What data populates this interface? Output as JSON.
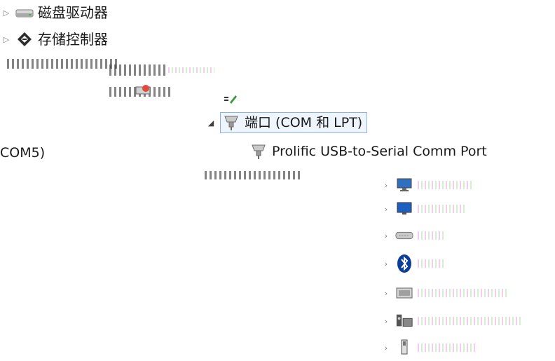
{
  "tree": {
    "disk_drives": {
      "label": "磁盘驱动器",
      "icon": "disk-drive-icon"
    },
    "storage_controllers": {
      "label": "存储控制器",
      "icon": "storage-controller-icon"
    },
    "ports": {
      "label": "端口 (COM 和 LPT)",
      "icon": "port-icon",
      "expanded": true
    },
    "port_device": {
      "label": "Prolific USB-to-Serial Comm Port",
      "icon": "serial-port-icon"
    },
    "port_device_tail": "COM5)"
  },
  "colors": {
    "selection_border": "#8db2e3",
    "selection_fill": "#eef5fd",
    "bluetooth": "#0b3e9a"
  }
}
